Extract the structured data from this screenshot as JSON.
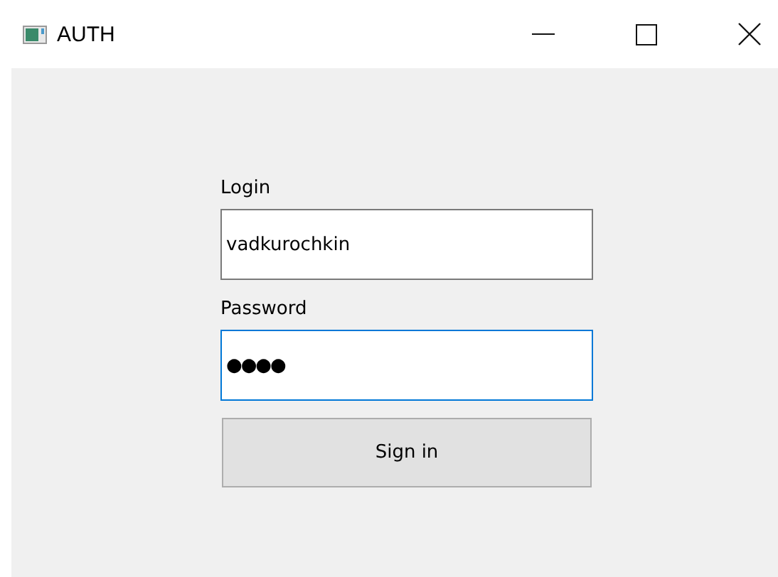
{
  "window": {
    "title": "AUTH"
  },
  "fields": [
    {
      "label": "Login",
      "value": "vadkurochkin",
      "focused": false
    },
    {
      "label": "Password",
      "value": "●●●●",
      "focused": true
    }
  ],
  "button": {
    "label": "Sign in"
  }
}
